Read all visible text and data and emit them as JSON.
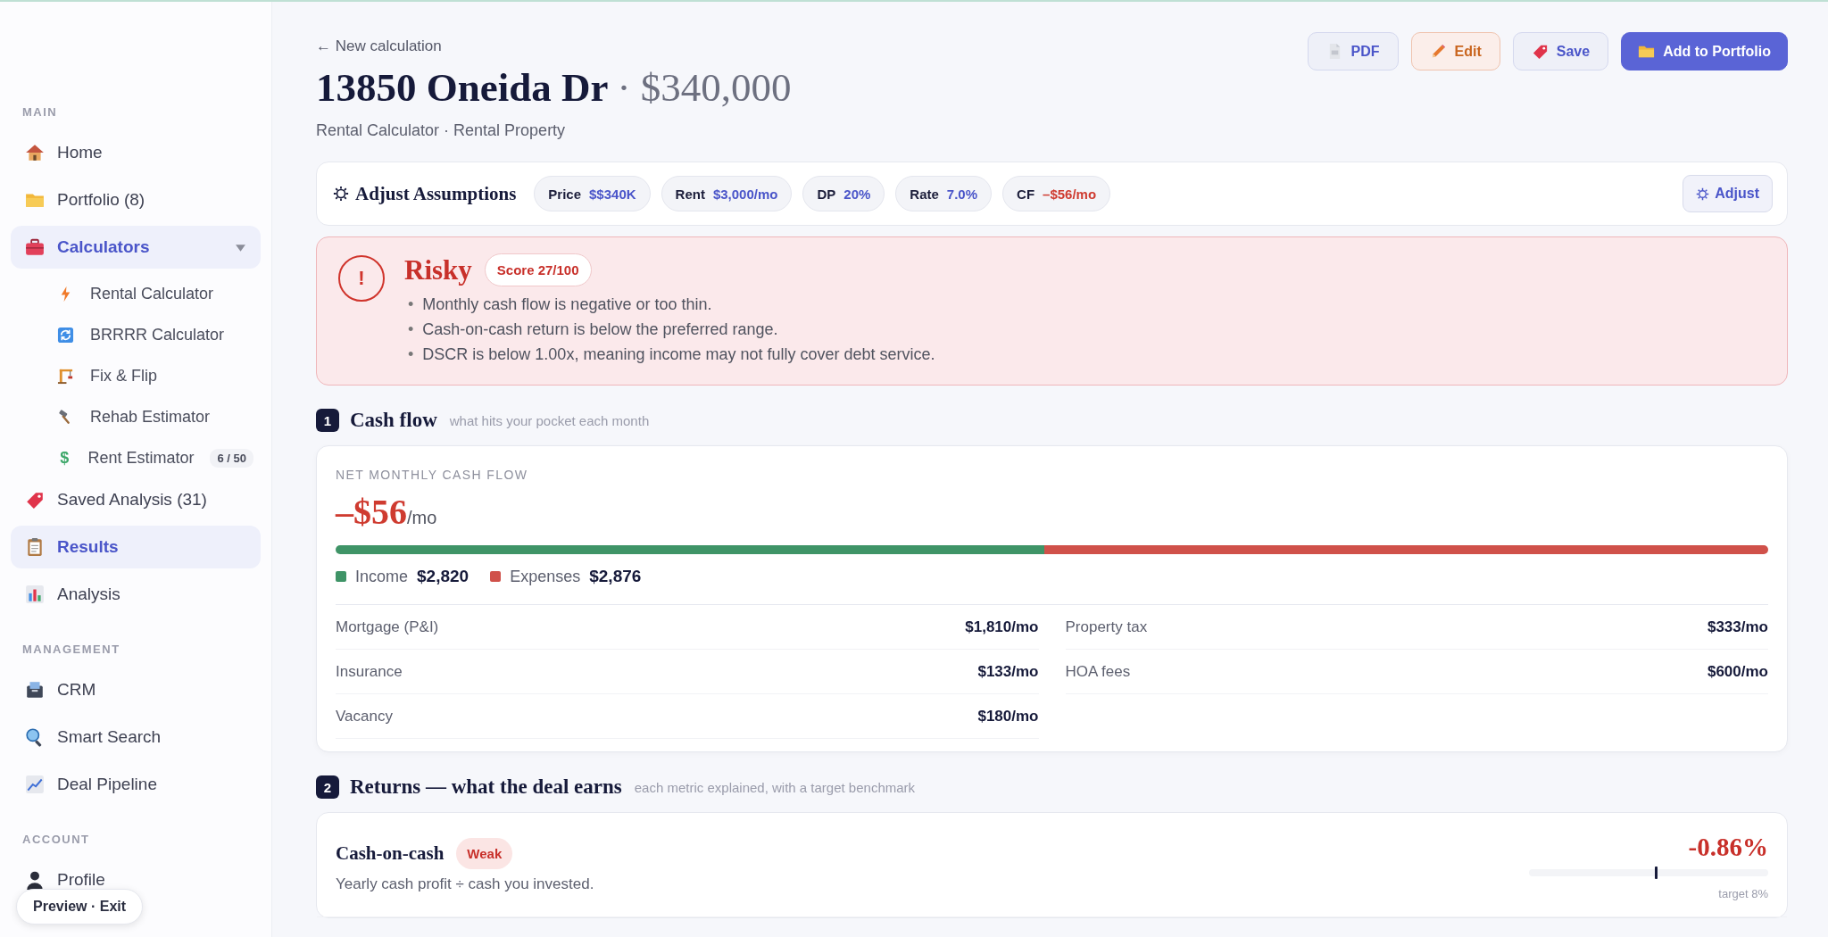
{
  "sidebar": {
    "sections": [
      {
        "title": "MAIN",
        "items": [
          {
            "label": "Home",
            "selected": false
          },
          {
            "label": "Portfolio (8)",
            "selected": false
          },
          {
            "label": "Calculators",
            "selected": true,
            "expanded": true,
            "children": [
              {
                "label": "Rental Calculator",
                "selected": false
              },
              {
                "label": "BRRRR Calculator",
                "selected": false
              },
              {
                "label": "Fix & Flip",
                "selected": false
              },
              {
                "label": "Rehab Estimator",
                "selected": false
              },
              {
                "label": "Rent Estimator",
                "selected": false,
                "glyph": "$",
                "badge": "6 / 50"
              }
            ]
          },
          {
            "label": "Saved Analysis (31)",
            "selected": false
          },
          {
            "label": "Results",
            "selected": true
          },
          {
            "label": "Analysis",
            "selected": false
          }
        ]
      },
      {
        "title": "MANAGEMENT",
        "items": [
          {
            "label": "CRM",
            "selected": false
          },
          {
            "label": "Smart Search",
            "selected": false
          },
          {
            "label": "Deal Pipeline",
            "selected": false
          }
        ]
      },
      {
        "title": "ACCOUNT",
        "items": [
          {
            "label": "Profile",
            "selected": false
          }
        ]
      }
    ],
    "preview_pill": "Preview · Exit"
  },
  "header": {
    "back_link": "← New calculation",
    "title": "13850 Oneida Dr",
    "price": "· $340,000",
    "subtitle": "Rental Calculator · Rental Property",
    "actions": [
      {
        "label": "PDF",
        "kind": "secondary"
      },
      {
        "label": "Edit",
        "kind": "warning"
      },
      {
        "label": "Save",
        "kind": "secondary"
      },
      {
        "label": "Add to Portfolio",
        "kind": "primary"
      }
    ]
  },
  "assumptions": {
    "title": "Adjust Assumptions",
    "chips": [
      {
        "label": "Price",
        "value": "$$340K",
        "negative": false
      },
      {
        "label": "Rent",
        "value": "$3,000/mo",
        "negative": false
      },
      {
        "label": "DP",
        "value": "20%",
        "negative": false
      },
      {
        "label": "Rate",
        "value": "7.0%",
        "negative": false
      },
      {
        "label": "CF",
        "value": "–$56/mo",
        "negative": true
      }
    ],
    "button": "Adjust"
  },
  "verdict": {
    "icon": "!",
    "label": "Risky",
    "score": "Score 27/100",
    "bullet": "•",
    "reasons": [
      "Monthly cash flow is negative or too thin.",
      "Cash-on-cash return is below the preferred range.",
      "DSCR is below 1.00x, meaning income may not fully cover debt service."
    ]
  },
  "sections": [
    {
      "kind": "cashflow",
      "number": "1",
      "title": "Cash flow",
      "hint": "what hits your pocket each month",
      "label": "NET MONTHLY CASH FLOW",
      "amount": "–$56",
      "unit": "/mo",
      "level": 0.495,
      "legend": [
        {
          "label": "Income",
          "value": "$2,820",
          "color": "#3f9467"
        },
        {
          "label": "Expenses",
          "value": "$2,876",
          "color": "#d0514a"
        }
      ],
      "rows": [
        {
          "label": "Mortgage (P&I)",
          "value": "$1,810/mo"
        },
        {
          "label": "Property tax",
          "value": "$333/mo"
        },
        {
          "label": "Insurance",
          "value": "$133/mo"
        },
        {
          "label": "HOA fees",
          "value": "$600/mo"
        },
        {
          "label": "Vacancy",
          "value": "$180/mo"
        }
      ]
    },
    {
      "kind": "returns",
      "number": "2",
      "title": "Returns — what the deal earns",
      "hint": "each metric explained, with a target benchmark",
      "metrics": [
        {
          "name": "Cash-on-cash",
          "badge": "Weak",
          "description": "Yearly cash profit ÷ cash you invested.",
          "value": "-0.86%",
          "level": 0.53,
          "target": "target 8%"
        }
      ]
    }
  ]
}
